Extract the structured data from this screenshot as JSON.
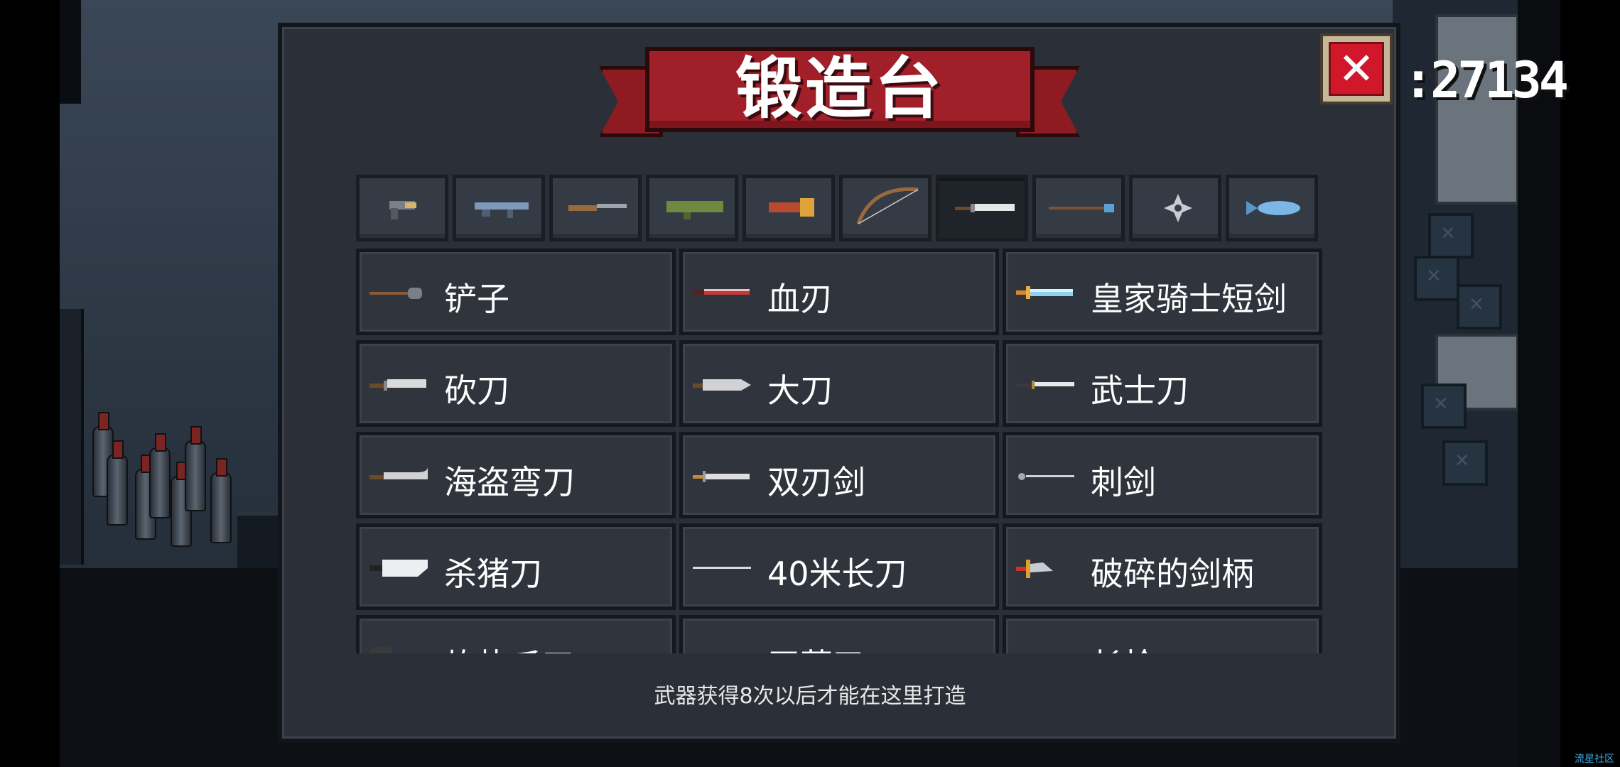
{
  "panel": {
    "title": "锻造台"
  },
  "hud": {
    "score": ":27134"
  },
  "close": {
    "glyph": "✕"
  },
  "tabs": [
    {
      "icon": "pistol-icon"
    },
    {
      "icon": "rifle-icon"
    },
    {
      "icon": "shotgun-icon"
    },
    {
      "icon": "rocket-launcher-icon"
    },
    {
      "icon": "flame-gun-icon"
    },
    {
      "icon": "bow-icon"
    },
    {
      "icon": "blade-icon"
    },
    {
      "icon": "spear-icon"
    },
    {
      "icon": "shuriken-icon"
    },
    {
      "icon": "fish-icon"
    }
  ],
  "active_tab": 6,
  "weapons": [
    {
      "name": "铲子",
      "icon": "shovel-icon"
    },
    {
      "name": "血刃",
      "icon": "blood-blade-icon"
    },
    {
      "name": "皇家骑士短剑",
      "icon": "royal-short-sword-icon"
    },
    {
      "name": "砍刀",
      "icon": "machete-icon"
    },
    {
      "name": "大刀",
      "icon": "broadsword-icon"
    },
    {
      "name": "武士刀",
      "icon": "katana-icon"
    },
    {
      "name": "海盗弯刀",
      "icon": "cutlass-icon"
    },
    {
      "name": "双刃剑",
      "icon": "double-edged-sword-icon"
    },
    {
      "name": "刺剑",
      "icon": "rapier-icon"
    },
    {
      "name": "杀猪刀",
      "icon": "cleaver-icon"
    },
    {
      "name": "40米长刀",
      "icon": "long-blade-icon"
    },
    {
      "name": "破碎的剑柄",
      "icon": "broken-hilt-icon"
    },
    {
      "name": "灼热爪刃",
      "icon": "claw-blade-icon"
    },
    {
      "name": "干草叉",
      "icon": "pitchfork-icon"
    },
    {
      "name": "长枪",
      "icon": "lance-icon"
    }
  ],
  "hint": "武器获得8次以后才能在这里打造",
  "watermark": "流星社区",
  "colors": {
    "ribbon": "#a11f29",
    "panel": "#2a2f38",
    "close": "#d0182a"
  }
}
